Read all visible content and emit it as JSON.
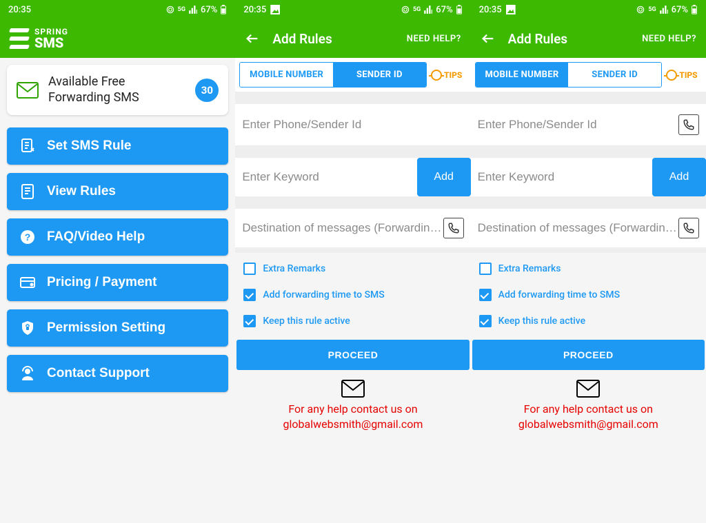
{
  "status": {
    "time": "20:35",
    "battery": "67%"
  },
  "brand": {
    "line1": "SPRING",
    "line2": "SMS"
  },
  "screen1": {
    "card": {
      "text": "Available Free Forwarding SMS",
      "badge": "30"
    },
    "menu": {
      "set_rule": "Set SMS Rule",
      "view_rules": "View Rules",
      "faq": "FAQ/Video Help",
      "pricing": "Pricing / Payment",
      "permission": "Permission Setting",
      "support": "Contact Support"
    }
  },
  "rules": {
    "title": "Add Rules",
    "need_help": "NEED HELP?",
    "tabs": {
      "mobile": "MOBILE NUMBER",
      "sender": "SENDER ID"
    },
    "tips": "TIPS",
    "ph_sender": "Enter Phone/Sender Id",
    "ph_keyword": "Enter Keyword",
    "add": "Add",
    "ph_dest": "Destination of messages (Forwardin…",
    "opts": {
      "extra": "Extra Remarks",
      "time": "Add forwarding time to SMS",
      "active": "Keep this rule active"
    },
    "proceed": "PROCEED",
    "help_line1": "For any help contact us on",
    "help_line2": "globalwebsmith@gmail.com"
  }
}
